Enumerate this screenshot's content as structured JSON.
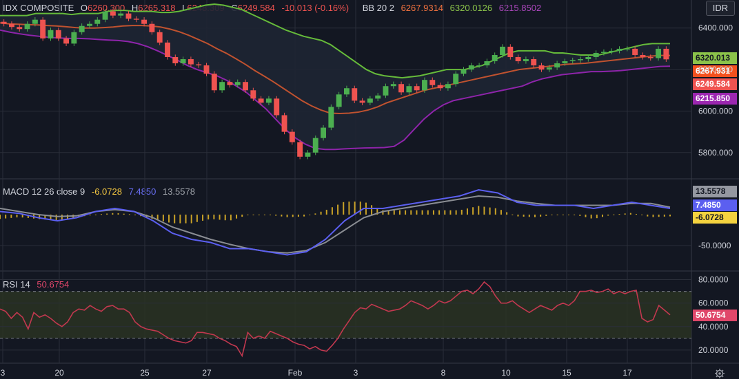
{
  "chart_data": [
    {
      "type": "candlestick",
      "symbol": "IDX COMPOSITE",
      "ohlc_label": {
        "o": "6260.300",
        "h": "6265.318",
        "l": "6248.309",
        "c": "6249.584",
        "change": "-10.013 (-0.16%)"
      },
      "indicator_label": "BB 20 2",
      "bb_values": {
        "basis": "6267.9314",
        "upper": "6320.0126",
        "lower": "6215.8502"
      },
      "currency": "IDR",
      "ylim": [
        5680,
        6535
      ],
      "y_ticks": [
        "6400.000",
        "6200.000",
        "6000.000",
        "5800.000"
      ],
      "y_tick_values": [
        6400,
        6200,
        6000,
        5800
      ],
      "price_tags": {
        "upper": "6320.013",
        "basis": "6267.931",
        "close": "6249.584",
        "lower": "6215.850"
      },
      "x_ticks": [
        "3",
        "20",
        "25",
        "27",
        "Feb",
        "3",
        "8",
        "10",
        "15",
        "17"
      ],
      "series_close": [
        6420,
        6405,
        6395,
        6420,
        6440,
        6350,
        6390,
        6350,
        6325,
        6380,
        6410,
        6420,
        6440,
        6480,
        6460,
        6470,
        6445,
        6440,
        6420,
        6380,
        6330,
        6260,
        6230,
        6250,
        6225,
        6220,
        6180,
        6100,
        6140,
        6125,
        6140,
        6100,
        6060,
        6040,
        6060,
        5980,
        5900,
        5850,
        5780,
        5800,
        5870,
        5920,
        6020,
        6080,
        6110,
        6050,
        6040,
        6060,
        6075,
        6120,
        6130,
        6090,
        6120,
        6100,
        6150,
        6125,
        6110,
        6130,
        6180,
        6200,
        6220,
        6220,
        6240,
        6270,
        6310,
        6260,
        6240,
        6250,
        6220,
        6200,
        6210,
        6230,
        6240,
        6245,
        6250,
        6260,
        6280,
        6285,
        6290,
        6300,
        6300,
        6270,
        6260,
        6255,
        6300,
        6249
      ],
      "bb_upper": [
        6460,
        6460,
        6460,
        6460,
        6470,
        6470,
        6470,
        6470,
        6465,
        6470,
        6470,
        6470,
        6480,
        6485,
        6485,
        6480,
        6480,
        6480,
        6475,
        6475,
        6480,
        6490,
        6500,
        6510,
        6515,
        6510,
        6500,
        6490,
        6470,
        6450,
        6430,
        6410,
        6390,
        6375,
        6360,
        6350,
        6340,
        6320,
        6290,
        6260,
        6230,
        6200,
        6180,
        6170,
        6165,
        6160,
        6165,
        6170,
        6180,
        6190,
        6200,
        6200,
        6200,
        6210,
        6220,
        6240,
        6260,
        6280,
        6290,
        6290,
        6290,
        6290,
        6280,
        6280,
        6275,
        6270,
        6270,
        6270,
        6280,
        6290,
        6300,
        6310,
        6320,
        6325,
        6325,
        6325
      ],
      "bb_basis": [
        6425,
        6420,
        6418,
        6416,
        6415,
        6412,
        6410,
        6406,
        6402,
        6400,
        6400,
        6402,
        6405,
        6410,
        6412,
        6412,
        6410,
        6405,
        6395,
        6382,
        6365,
        6345,
        6325,
        6300,
        6278,
        6252,
        6225,
        6195,
        6168,
        6140,
        6110,
        6080,
        6050,
        6025,
        6005,
        5990,
        5988,
        5990,
        5995,
        6005,
        6020,
        6040,
        6055,
        6070,
        6085,
        6100,
        6110,
        6120,
        6130,
        6140,
        6150,
        6160,
        6170,
        6180,
        6190,
        6200,
        6205,
        6210,
        6215,
        6220,
        6225,
        6228,
        6230,
        6235,
        6240,
        6245,
        6250,
        6255,
        6260,
        6265,
        6268,
        6268
      ],
      "bb_lower": [
        6390,
        6380,
        6372,
        6365,
        6360,
        6355,
        6352,
        6350,
        6350,
        6348,
        6345,
        6342,
        6340,
        6335,
        6325,
        6310,
        6290,
        6268,
        6245,
        6220,
        6200,
        6185,
        6170,
        6148,
        6120,
        6090,
        6050,
        6010,
        5960,
        5910,
        5870,
        5840,
        5820,
        5815,
        5815,
        5818,
        5820,
        5822,
        5823,
        5824,
        5830,
        5860,
        5910,
        5960,
        6000,
        6030,
        6050,
        6060,
        6070,
        6080,
        6090,
        6100,
        6110,
        6120,
        6140,
        6155,
        6165,
        6175,
        6180,
        6185,
        6190,
        6190,
        6192,
        6195,
        6200,
        6205,
        6210,
        6215,
        6216
      ]
    },
    {
      "type": "line",
      "indicator_label": "MACD 12 26 close 9",
      "values_label": {
        "histogram": "-6.0728",
        "macd": "7.4850",
        "signal": "13.5578"
      },
      "y_ticks": [
        "-50.0000"
      ],
      "tags": {
        "signal": "13.5578",
        "macd": "7.4850",
        "histogram": "-6.0728"
      }
    },
    {
      "type": "line",
      "indicator_label": "RSI 14",
      "value_label": "50.6754",
      "ylim": [
        10,
        85
      ],
      "y_ticks": [
        "80.0000",
        "60.0000",
        "40.0000",
        "20.0000"
      ],
      "y_tick_values": [
        80,
        60,
        40,
        20
      ],
      "band": [
        30,
        70
      ],
      "tag": "50.6754",
      "series": [
        55,
        53,
        47,
        52,
        48,
        38,
        52,
        48,
        50,
        47,
        43,
        40,
        44,
        52,
        55,
        54,
        58,
        55,
        53,
        57,
        58,
        55,
        55,
        52,
        44,
        40,
        38,
        37,
        36,
        33,
        30,
        28,
        27,
        26,
        28,
        35,
        35,
        34,
        33,
        30,
        28,
        25,
        23,
        15,
        35,
        30,
        32,
        30,
        36,
        34,
        32,
        30,
        27,
        25,
        24,
        21,
        23,
        20,
        19,
        24,
        30,
        38,
        45,
        52,
        56,
        55,
        59,
        57,
        55,
        53,
        54,
        55,
        58,
        62,
        60,
        58,
        55,
        58,
        62,
        60,
        62,
        66,
        70,
        71,
        68,
        72,
        78,
        74,
        66,
        60,
        60,
        62,
        58,
        55,
        52,
        55,
        58,
        56,
        54,
        58,
        60,
        58,
        62,
        70,
        70,
        71,
        69,
        70,
        72,
        68,
        70,
        68,
        70,
        71,
        47,
        44,
        46,
        58,
        54,
        50
      ]
    }
  ]
}
